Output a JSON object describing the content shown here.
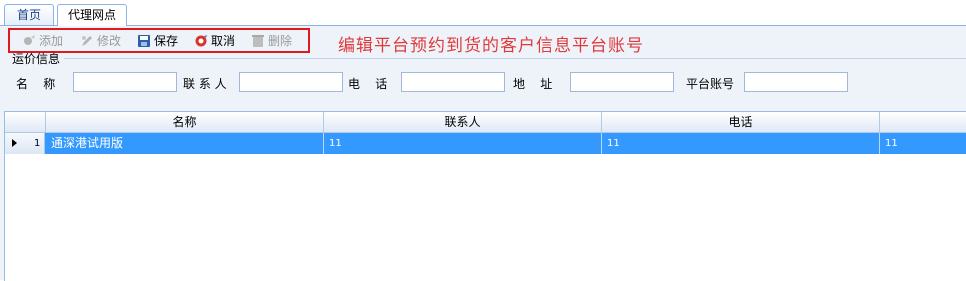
{
  "tabs": [
    {
      "label": "首页"
    },
    {
      "label": "代理网点"
    }
  ],
  "toolbar": {
    "add": "添加",
    "edit": "修改",
    "save": "保存",
    "cancel": "取消",
    "delete": "删除"
  },
  "annotation": "编辑平台预约到货的客户信息平台账号",
  "form": {
    "group_title": "运价信息",
    "fields": [
      {
        "label": "名    称",
        "value": ""
      },
      {
        "label": "联 系 人",
        "value": ""
      },
      {
        "label": "电    话",
        "value": ""
      },
      {
        "label": "地    址",
        "value": ""
      },
      {
        "label": "平台账号",
        "value": ""
      }
    ]
  },
  "grid": {
    "columns": [
      "名称",
      "联系人",
      "电话"
    ],
    "rows": [
      {
        "index": "1",
        "name": "通深港试用版",
        "contact": "11",
        "phone": "11",
        "extra": "11"
      }
    ]
  },
  "colors": {
    "selection": "#3399ff",
    "annotation": "#e03a3a",
    "highlight_box": "#e0191f"
  }
}
